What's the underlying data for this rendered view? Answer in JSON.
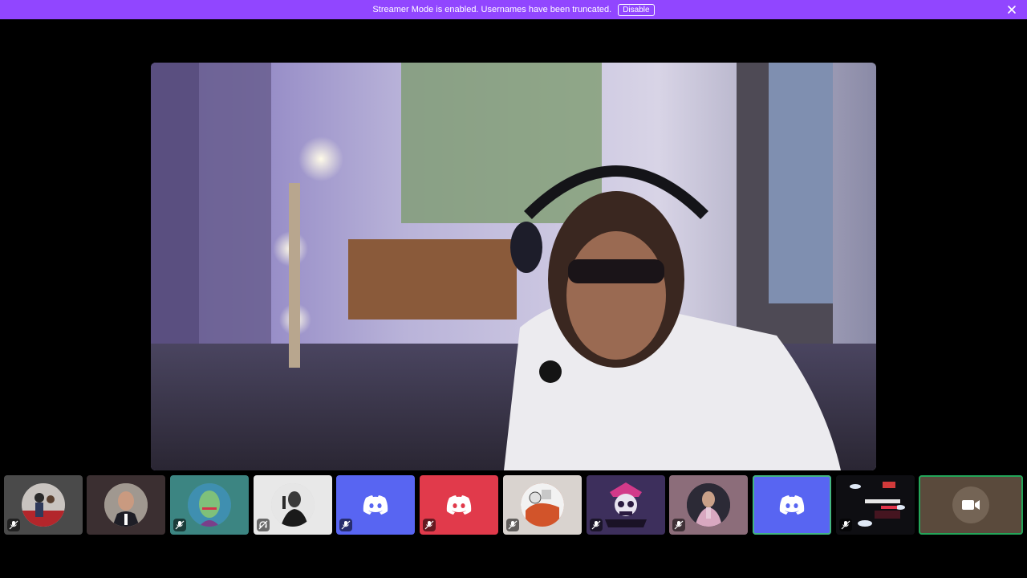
{
  "banner": {
    "message": "Streamer Mode is enabled. Usernames have been truncated.",
    "disable_label": "Disable",
    "bg_color": "#9146ff"
  },
  "stage": {
    "description_icon": "video-stream"
  },
  "tiles": [
    {
      "kind": "avatar",
      "bg": "#4a4a4a",
      "avatar_bg": "#6b6b6b",
      "muted": true
    },
    {
      "kind": "avatar",
      "bg": "#3b2f31",
      "avatar_bg": "#9a8b80",
      "muted": false
    },
    {
      "kind": "avatar",
      "bg": "#3c8582",
      "avatar_bg": "#4f9a7a",
      "muted": true
    },
    {
      "kind": "avatar",
      "bg": "#e8e8e8",
      "avatar_bg": "#d0d0d0",
      "muted": true
    },
    {
      "kind": "logo",
      "bg": "#5865f2",
      "muted": true
    },
    {
      "kind": "logo",
      "bg": "#e13a4b",
      "muted": true
    },
    {
      "kind": "avatar",
      "bg": "#d9d3cf",
      "avatar_bg": "#c45533",
      "muted": true
    },
    {
      "kind": "avatar",
      "bg": "#3d2f5c",
      "avatar_bg": "#6a3ea8",
      "muted": true
    },
    {
      "kind": "avatar",
      "bg": "#8c6d7a",
      "avatar_bg": "#2f2a35",
      "muted": true
    },
    {
      "kind": "logo",
      "bg": "#5865f2",
      "muted": false,
      "focused": true
    },
    {
      "kind": "banner-art",
      "bg": "#111111",
      "muted": true
    },
    {
      "kind": "camera",
      "bg": "#5a4a3c",
      "muted": false,
      "selected": true
    }
  ]
}
